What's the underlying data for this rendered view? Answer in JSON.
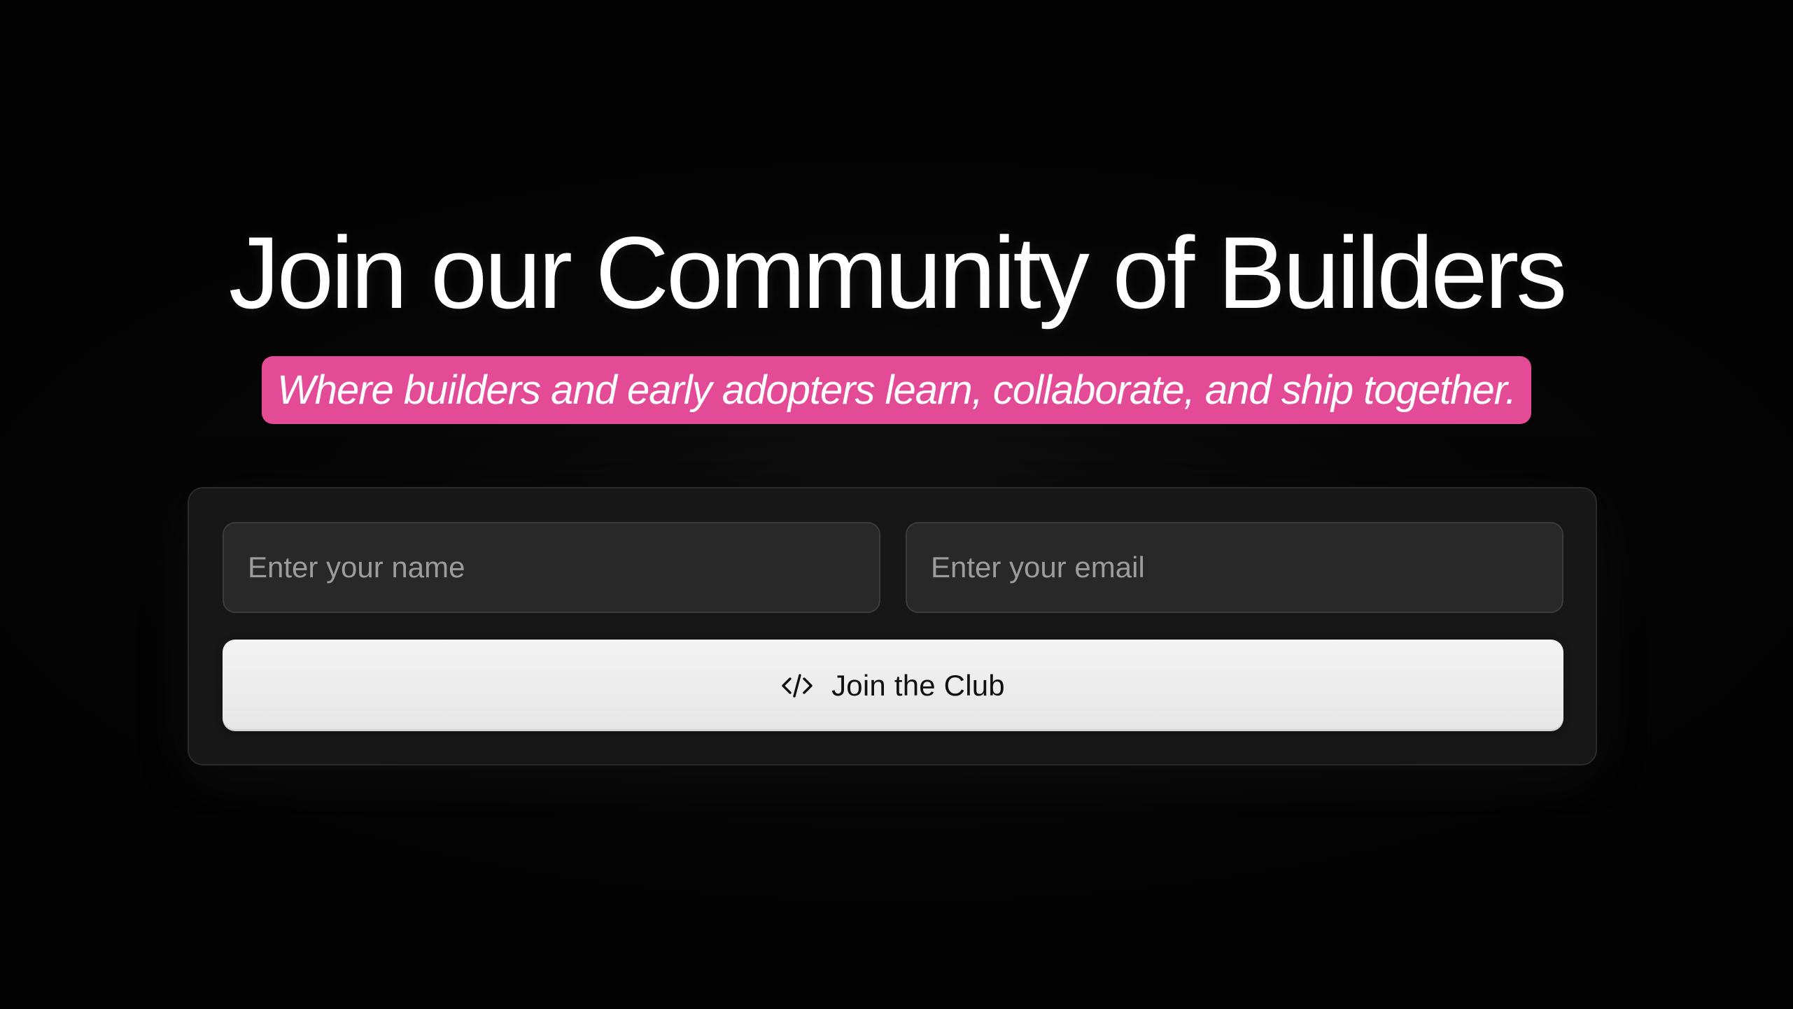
{
  "hero": {
    "title": "Join our Community of Builders",
    "tagline": "Where builders and early adopters learn, collaborate, and ship together."
  },
  "form": {
    "name_placeholder": "Enter your name",
    "name_value": "",
    "email_placeholder": "Enter your email",
    "email_value": "",
    "submit_label": "Join the Club",
    "submit_icon": "code-icon"
  },
  "colors": {
    "background": "#030303",
    "tagline_highlight": "#e44b97",
    "card": "#171717",
    "input": "#282828",
    "button": "#ececec"
  }
}
